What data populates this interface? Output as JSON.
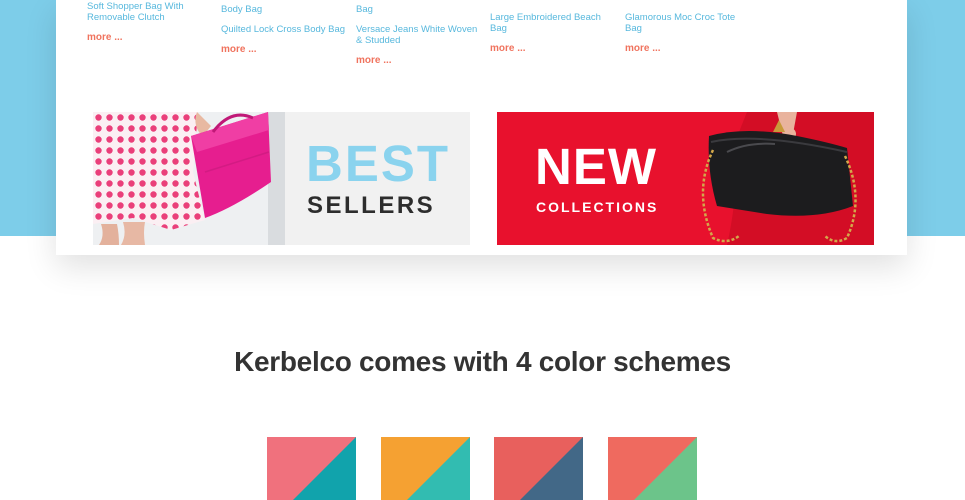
{
  "menu": {
    "columns": [
      {
        "items": [
          "Soft Shopper Bag With Removable Clutch"
        ],
        "more": "more ..."
      },
      {
        "partial": "Body Bag",
        "items": [
          "Quilted Lock Cross Body Bag"
        ],
        "more": "more ..."
      },
      {
        "partial": "Bag",
        "items": [
          "Versace Jeans White Woven & Studded"
        ],
        "more": "more ..."
      },
      {
        "items": [
          "Large Embroidered Beach Bag"
        ],
        "more": "more ..."
      },
      {
        "items": [
          "Glamorous Moc Croc Tote Bag"
        ],
        "more": "more ..."
      }
    ]
  },
  "banners": {
    "best": {
      "title": "BEST",
      "subtitle": "SELLERS",
      "title_color": "#8ad3ee",
      "subtitle_color": "#2d2d2d"
    },
    "new": {
      "title": "NEW",
      "subtitle": "COLLECTIONS",
      "background": "#e8112d"
    }
  },
  "headline": "Kerbelco comes with 4 color schemes",
  "schemes": [
    {
      "name": "coral-teal",
      "primary": "#f0717d",
      "secondary": "#11a3ac"
    },
    {
      "name": "orange-teal",
      "primary": "#f5a132",
      "secondary": "#32bcb1"
    },
    {
      "name": "red-navy",
      "primary": "#e8605d",
      "secondary": "#426887"
    },
    {
      "name": "salmon-green",
      "primary": "#ef6a5f",
      "secondary": "#6cc48a"
    }
  ],
  "colors": {
    "band": "#7dcde9",
    "link": "#57b8dd",
    "more": "#f0735e"
  }
}
